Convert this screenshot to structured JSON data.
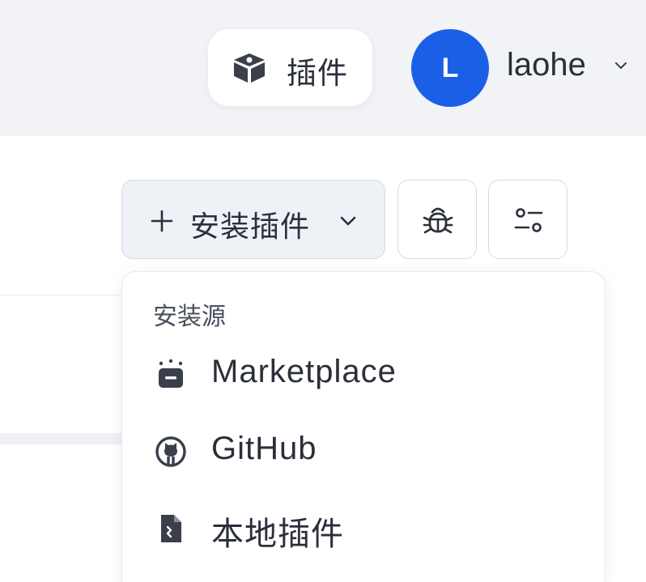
{
  "header": {
    "plugins_label": "插件",
    "avatar_initial": "L",
    "username": "laohe",
    "avatar_color": "#1b5fe6"
  },
  "toolbar": {
    "install_label": "安装插件",
    "debug_icon": "bug-icon",
    "filter_icon": "settings-sliders-icon"
  },
  "dropdown": {
    "section_title": "安装源",
    "items": [
      {
        "label": "Marketplace",
        "icon": "marketplace-icon"
      },
      {
        "label": "GitHub",
        "icon": "github-icon"
      },
      {
        "label": "本地插件",
        "icon": "local-file-icon"
      }
    ]
  }
}
